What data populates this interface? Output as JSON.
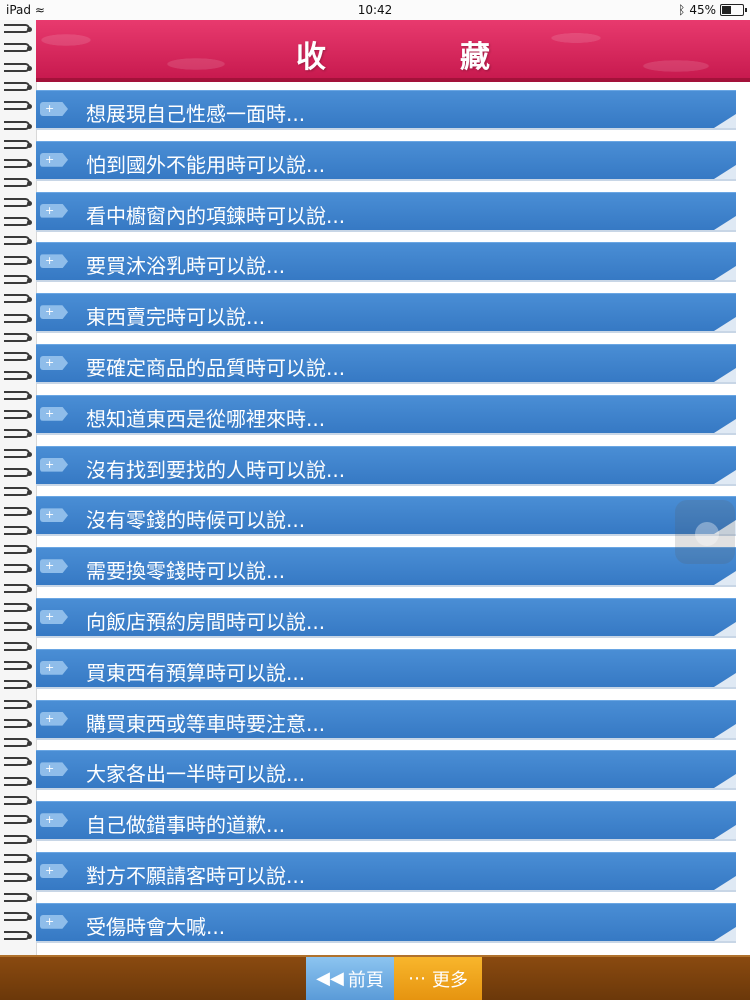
{
  "status_bar": {
    "device": "iPad",
    "time": "10:42",
    "bluetooth_icon": "bluetooth-icon",
    "battery_percent": "45%"
  },
  "header": {
    "title": "收　藏",
    "background_color": "#d9245b"
  },
  "list": {
    "items": [
      {
        "label": "想展現自己性感一面時..."
      },
      {
        "label": "怕到國外不能用時可以說..."
      },
      {
        "label": "看中櫥窗內的項鍊時可以說..."
      },
      {
        "label": "要買沐浴乳時可以說..."
      },
      {
        "label": "東西賣完時可以說..."
      },
      {
        "label": "要確定商品的品質時可以說..."
      },
      {
        "label": "想知道東西是從哪裡來時..."
      },
      {
        "label": "沒有找到要找的人時可以說..."
      },
      {
        "label": "沒有零錢的時候可以說..."
      },
      {
        "label": "需要換零錢時可以說..."
      },
      {
        "label": "向飯店預約房間時可以說..."
      },
      {
        "label": "買東西有預算時可以說..."
      },
      {
        "label": "購買東西或等車時要注意..."
      },
      {
        "label": "大家各出一半時可以說..."
      },
      {
        "label": "自己做錯事時的道歉..."
      },
      {
        "label": "對方不願請客時可以說..."
      },
      {
        "label": "受傷時會大喊..."
      }
    ],
    "item_color": "#3f84cd",
    "expand_icon": "plus-tab-icon"
  },
  "bottom_bar": {
    "prev_label": "前頁",
    "prev_icon": "rewind-icon",
    "more_label": "更多",
    "more_icon": "ellipsis-icon",
    "prev_color": "#6aaae2",
    "more_color": "#f0a11c"
  }
}
